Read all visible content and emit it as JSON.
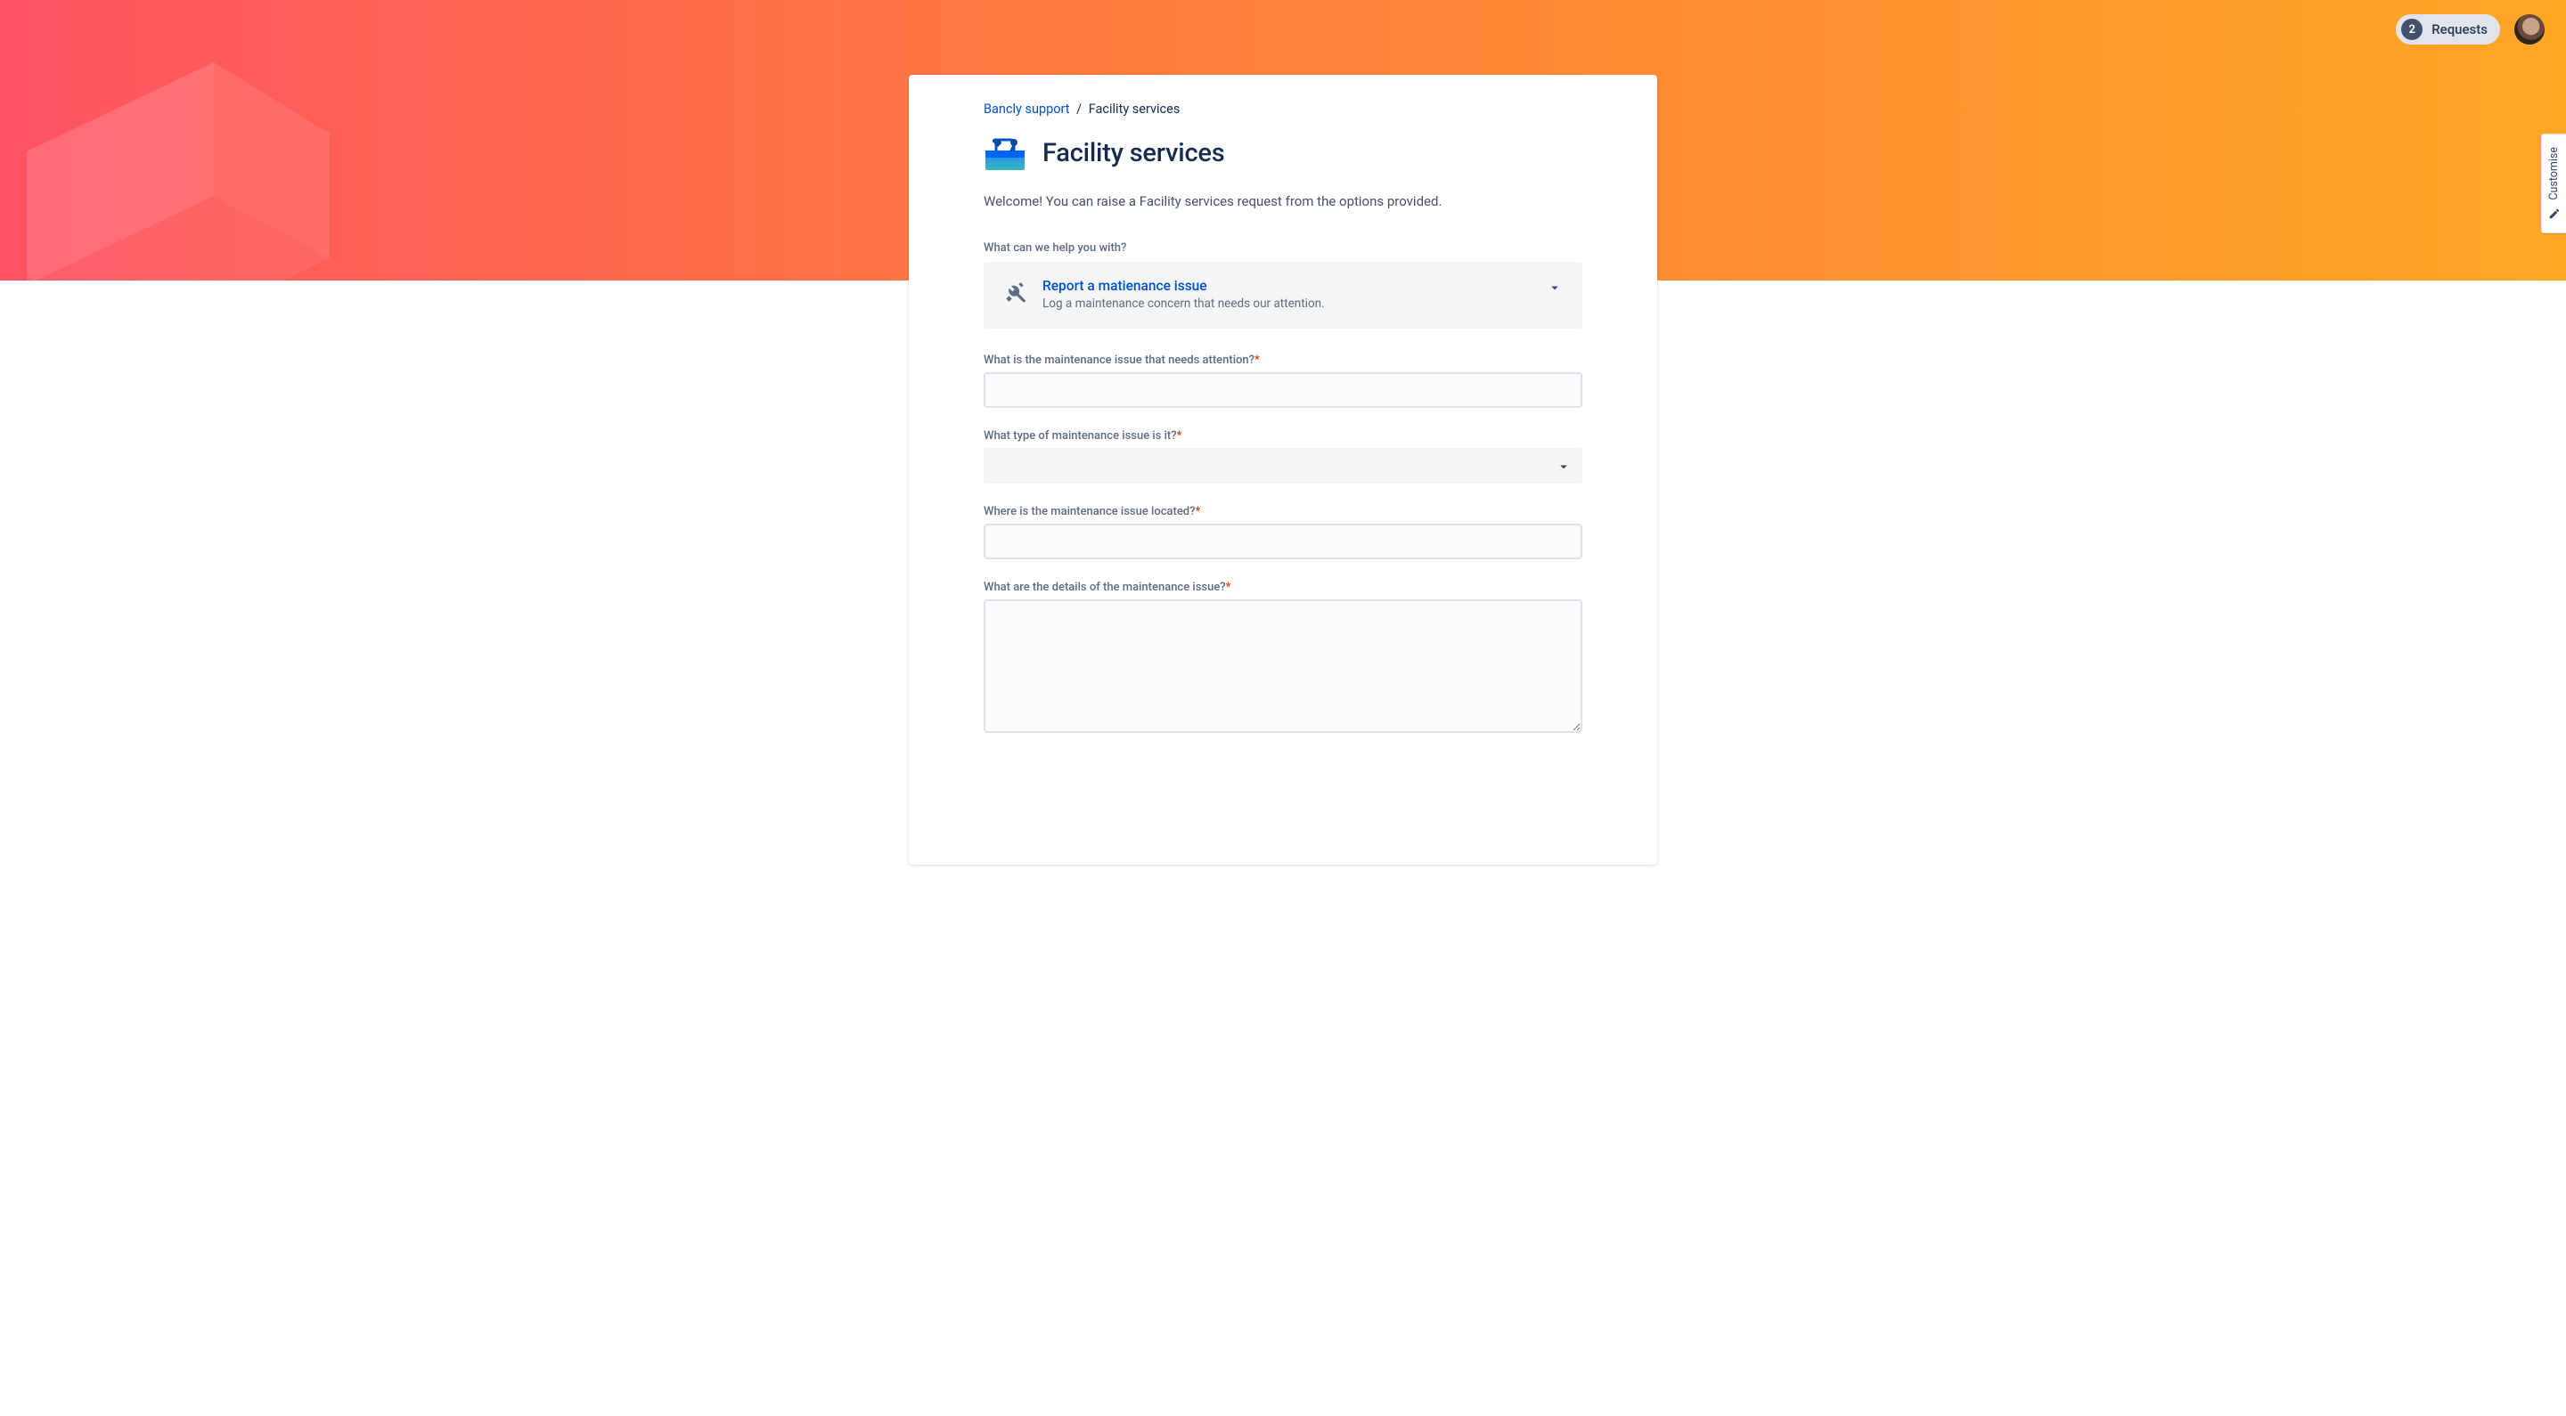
{
  "header": {
    "requests_count": "2",
    "requests_label": "Requests"
  },
  "customise": {
    "label": "Customise"
  },
  "breadcrumb": {
    "root": "Bancly support",
    "separator": "/",
    "current": "Facility services"
  },
  "page": {
    "title": "Facility services",
    "welcome": "Welcome! You can raise a Facility services request from the options provided."
  },
  "help_prompt": "What can we help you with?",
  "request_type": {
    "title": "Report a matienance issue",
    "description": "Log a maintenance concern that needs our attention."
  },
  "fields": {
    "issue": {
      "label": "What is the maintenance issue that needs attention?",
      "required": true,
      "value": ""
    },
    "type": {
      "label": "What type of maintenance issue is it?",
      "required": true,
      "value": ""
    },
    "location": {
      "label": "Where is the maintenance issue located?",
      "required": true,
      "value": ""
    },
    "details": {
      "label": "What are the details of the maintenance issue?",
      "required": true,
      "value": ""
    }
  }
}
